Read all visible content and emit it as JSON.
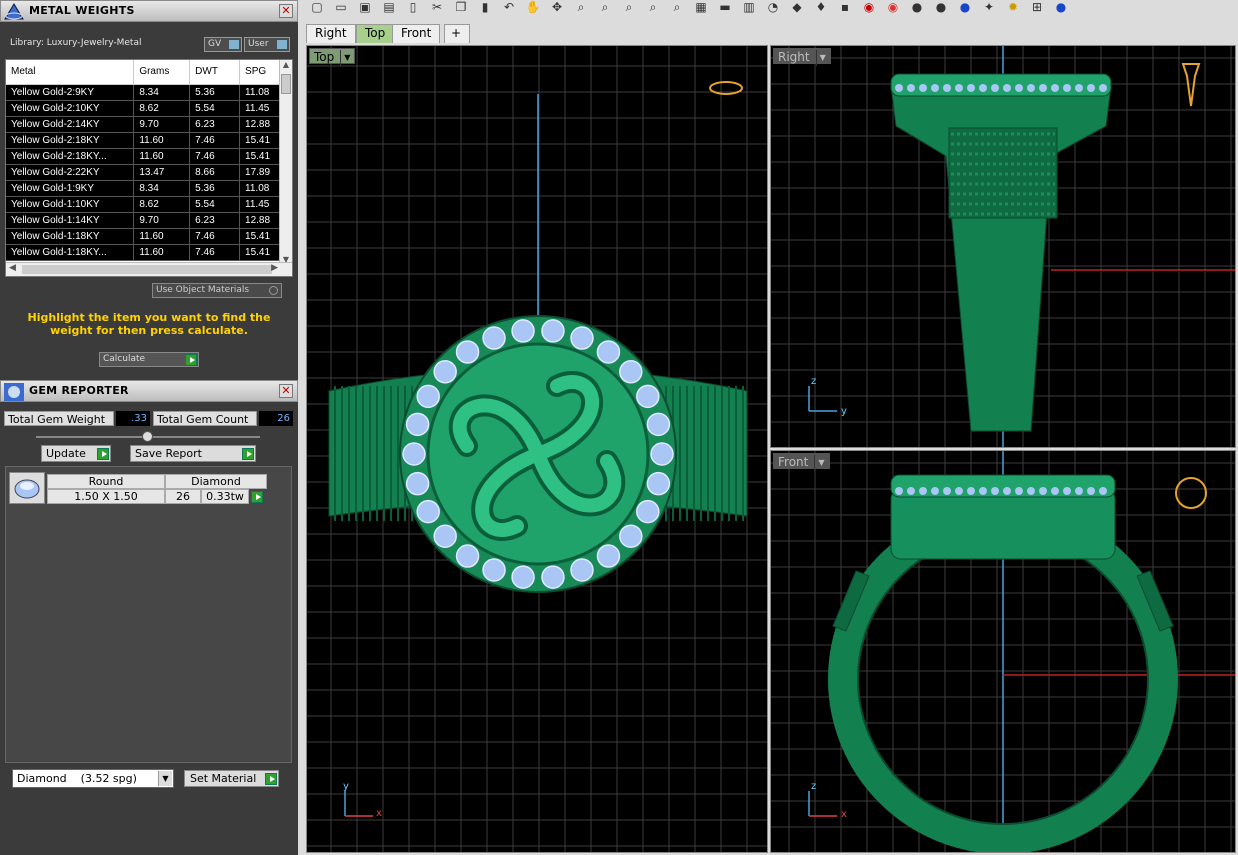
{
  "metal_weights": {
    "title": "METAL WEIGHTS",
    "library": "Library: Luxury-Jewelry-Metal",
    "toggle_gv": "GV",
    "toggle_user": "User",
    "columns": [
      "Metal",
      "Grams",
      "DWT",
      "SPG"
    ],
    "rows": [
      [
        "Yellow Gold-2:9KY",
        "8.34",
        "5.36",
        "11.08"
      ],
      [
        "Yellow Gold-2:10KY",
        "8.62",
        "5.54",
        "11.45"
      ],
      [
        "Yellow Gold-2:14KY",
        "9.70",
        "6.23",
        "12.88"
      ],
      [
        "Yellow Gold-2:18KY",
        "11.60",
        "7.46",
        "15.41"
      ],
      [
        "Yellow Gold-2:18KY...",
        "11.60",
        "7.46",
        "15.41"
      ],
      [
        "Yellow Gold-2:22KY",
        "13.47",
        "8.66",
        "17.89"
      ],
      [
        "Yellow Gold-1:9KY",
        "8.34",
        "5.36",
        "11.08"
      ],
      [
        "Yellow Gold-1:10KY",
        "8.62",
        "5.54",
        "11.45"
      ],
      [
        "Yellow Gold-1:14KY",
        "9.70",
        "6.23",
        "12.88"
      ],
      [
        "Yellow Gold-1:18KY",
        "11.60",
        "7.46",
        "15.41"
      ],
      [
        "Yellow Gold-1:18KY...",
        "11.60",
        "7.46",
        "15.41"
      ]
    ],
    "use_object_materials": "Use Object Materials",
    "hint": "Highlight the item you want to find the weight for then press calculate.",
    "calculate": "Calculate"
  },
  "gem_reporter": {
    "title": "GEM REPORTER",
    "total_weight_label": "Total Gem Weight",
    "total_weight_value": ".33",
    "total_count_label": "Total Gem Count",
    "total_count_value": "26",
    "update": "Update",
    "save_report": "Save Report",
    "gem": {
      "shape": "Round",
      "material": "Diamond",
      "size": "1.50 X 1.50",
      "count": "26",
      "weight": "0.33tw"
    },
    "material_select": "Diamond    (3.52 spg)",
    "set_material": "Set Material"
  },
  "viewports": {
    "tabs": [
      "Right",
      "Top",
      "Front"
    ],
    "active_tab": "Top",
    "top_label": "Top",
    "right_label": "Right",
    "front_label": "Front",
    "axis_x": "x",
    "axis_y": "y",
    "axis_z": "z"
  },
  "colors": {
    "ring": "#1fa36b",
    "gem": "#a9c6f5",
    "grid": "#3c3c3c"
  }
}
